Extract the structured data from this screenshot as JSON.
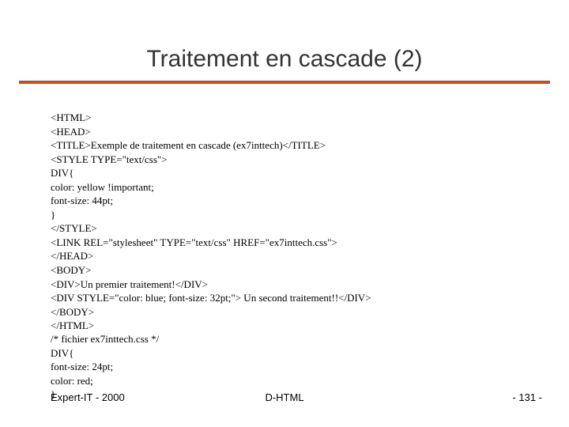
{
  "title": "Traitement en cascade (2)",
  "code_block": "<HTML>\n<HEAD>\n<TITLE>Exemple de traitement en cascade (ex7inttech)</TITLE>\n<STYLE TYPE=\"text/css\">\nDIV{\ncolor: yellow !important;\nfont-size: 44pt;\n}\n</STYLE>\n<LINK REL=\"stylesheet\" TYPE=\"text/css\" HREF=\"ex7inttech.css\">\n</HEAD>\n<BODY>\n<DIV>Un premier traitement!</DIV>\n<DIV STYLE=\"color: blue; font-size: 32pt;\"> Un second traitement!!</DIV>\n</BODY>\n</HTML>",
  "css_file_block": "/* fichier ex7inttech.css */\nDIV{\nfont-size: 24pt;\ncolor: red;\n}",
  "footer": {
    "left": "Expert-IT - 2000",
    "center": "D-HTML",
    "right": "- 131 -"
  }
}
